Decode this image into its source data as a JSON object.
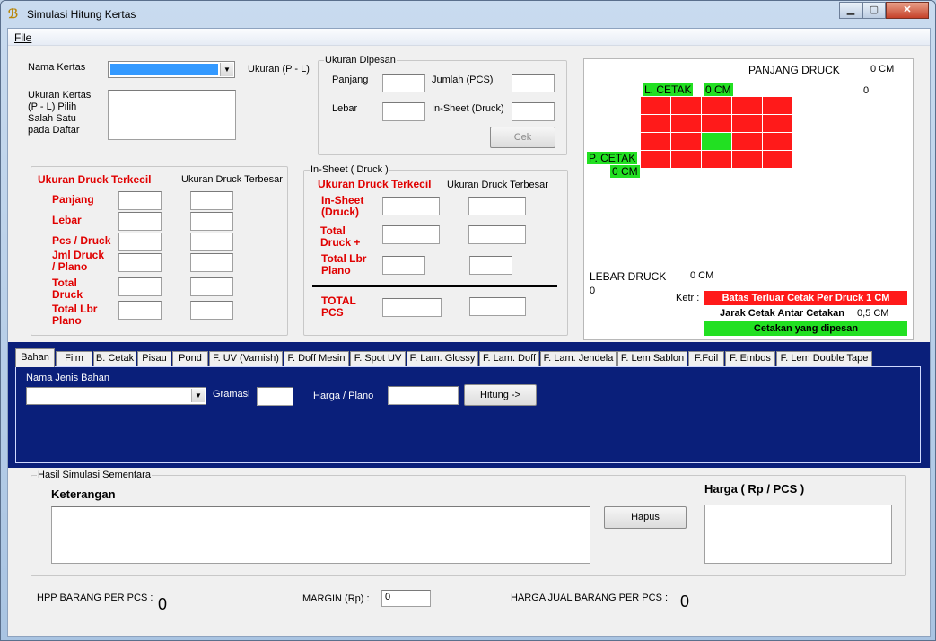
{
  "window": {
    "title": "Simulasi Hitung Kertas"
  },
  "menu": {
    "file": "File"
  },
  "form": {
    "nama_kertas_label": "Nama Kertas",
    "ukuran_pl_label": "Ukuran (P - L)",
    "ukuran_kertas_help": [
      "Ukuran Kertas",
      "(P - L) Pilih",
      "Salah Satu",
      "pada Daftar"
    ]
  },
  "ukuran_dipesan": {
    "title": "Ukuran Dipesan",
    "panjang": "Panjang",
    "lebar": "Lebar",
    "jumlah_pcs": "Jumlah (PCS)",
    "in_sheet_druck": "In-Sheet (Druck)",
    "cek_button": "Cek"
  },
  "ukuran_druck": {
    "terkecil": "Ukuran Druck Terkecil",
    "terbesar": "Ukuran Druck Terbesar",
    "panjang": "Panjang",
    "lebar": "Lebar",
    "pcs_druck": "Pcs / Druck",
    "jml_druck": [
      "Jml Druck",
      "/ Plano"
    ],
    "total_druck": [
      "Total",
      "Druck"
    ],
    "total_lbr": [
      "Total Lbr",
      "Plano"
    ]
  },
  "in_sheet": {
    "title": "In-Sheet ( Druck )",
    "terkecil": "Ukuran Druck Terkecil",
    "terbesar": "Ukuran Druck Terbesar",
    "in_sheet": [
      "In-Sheet",
      "(Druck)"
    ],
    "total_druck": [
      "Total",
      "Druck +"
    ],
    "total_lbr": [
      "Total Lbr",
      "Plano"
    ],
    "total_pcs": [
      "TOTAL",
      "PCS"
    ]
  },
  "diagram": {
    "panjang_druck_label": "PANJANG DRUCK",
    "panjang_druck_value": "0 CM",
    "top_right_zero": "0",
    "l_cetak": "L. CETAK",
    "l_cetak_value": "0 CM",
    "p_cetak": "P. CETAK",
    "p_cetak_value": "0 CM",
    "lebar_druck_label": "LEBAR DRUCK",
    "lebar_druck_value": "0 CM",
    "bottom_left_zero": "0",
    "ketr_label": "Ketr :",
    "legend_red": "Batas Terluar Cetak Per Druck 1 CM",
    "legend_white": "Jarak Cetak Antar Cetakan",
    "legend_white_value": "0,5 CM",
    "legend_green": "Cetakan yang dipesan",
    "colors": {
      "outer": "#ff1a1a",
      "selected": "#22e022"
    }
  },
  "tabs": [
    "Bahan",
    "Film",
    "B. Cetak",
    "Pisau",
    "Pond",
    "F. UV (Varnish)",
    "F. Doff Mesin",
    "F. Spot UV",
    "F. Lam. Glossy",
    "F. Lam. Doff",
    "F. Lam. Jendela",
    "F. Lem Sablon",
    "F.Foil",
    "F. Embos",
    "F. Lem Double Tape"
  ],
  "bahan": {
    "nama_jenis_label": "Nama Jenis Bahan",
    "gramasi_label": "Gramasi",
    "harga_plano_label": "Harga / Plano",
    "hitung_button": "Hitung ->"
  },
  "hasil": {
    "title": "Hasil Simulasi Sementara",
    "keterangan": "Keterangan",
    "harga_label": "Harga ( Rp / PCS )",
    "hapus_button": "Hapus"
  },
  "footer": {
    "hpp_label": "HPP BARANG PER PCS :",
    "hpp_value": "0",
    "margin_label": "MARGIN (Rp) :",
    "margin_value": "0",
    "harga_jual_label": "HARGA JUAL BARANG PER PCS :",
    "harga_jual_value": "0"
  }
}
